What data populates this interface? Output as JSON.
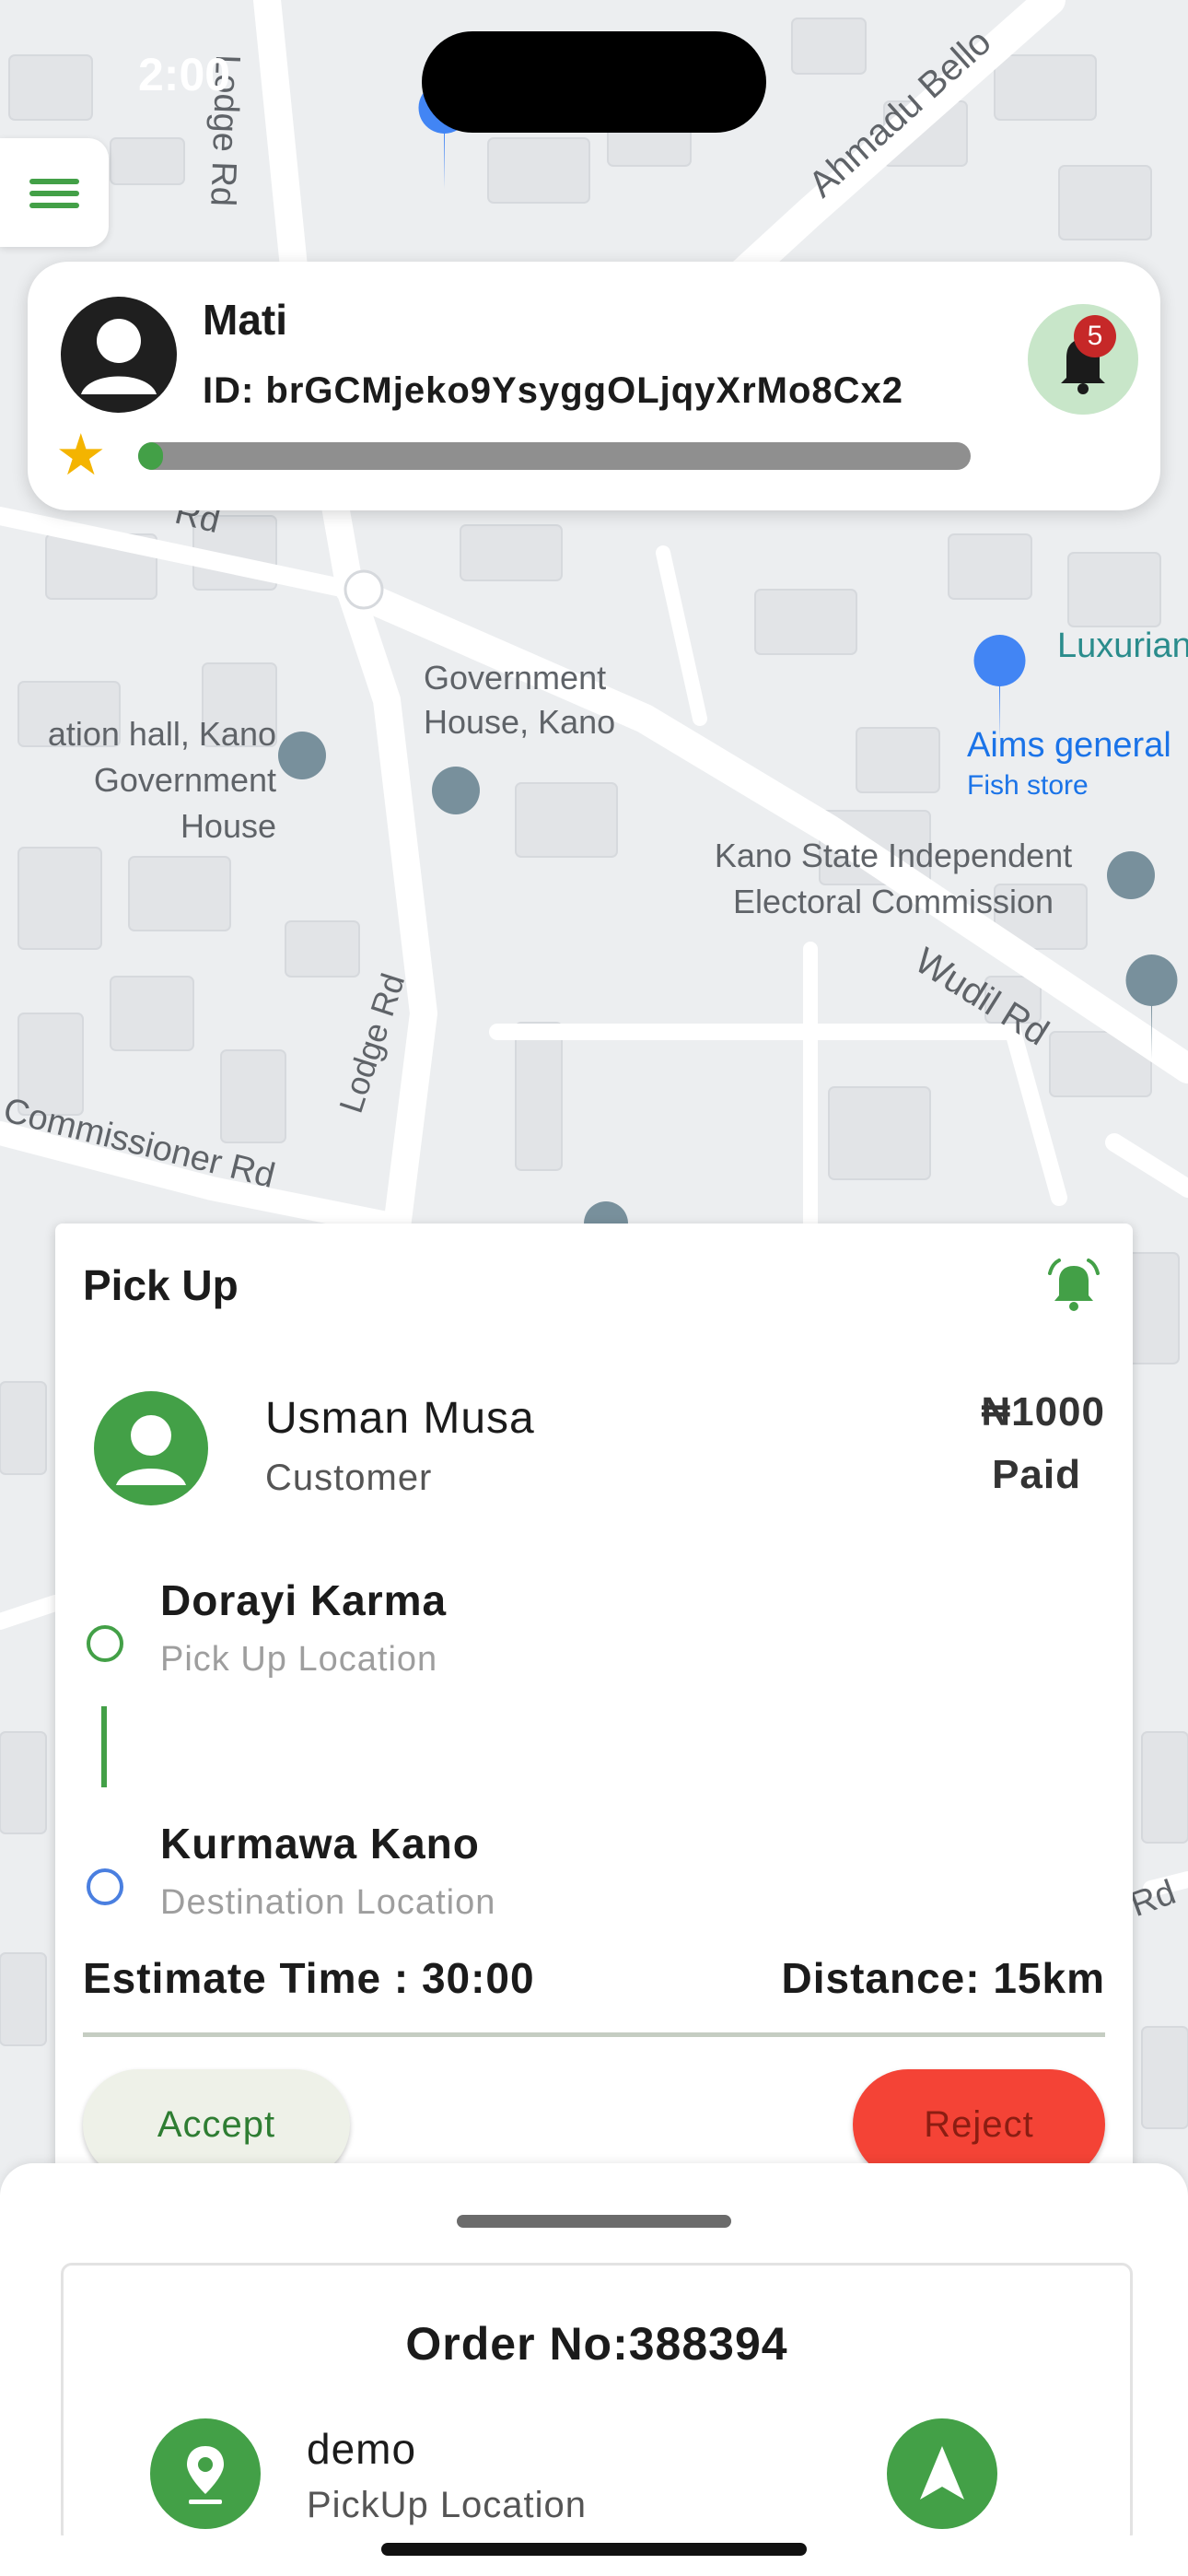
{
  "status_bar": {
    "time": "2:00"
  },
  "map": {
    "streets": [
      "Lodge Rd",
      "Ahmadu Bello",
      "Rd",
      "Wudil Rd",
      "Lodge Rd",
      "Commissioner Rd",
      "Rd"
    ],
    "places": [
      "Government House, Kano",
      "ation hall, Kano Government House",
      "Luxurian",
      "Aims general",
      "Fish store",
      "Kano State Independent Electoral Commission"
    ]
  },
  "profile": {
    "name": "Mati",
    "id": "ID: brGCMjeko9YsyggOLjqyXrMo8Cx2",
    "progress": 0.03,
    "notification_count": "5"
  },
  "pickup": {
    "title": "Pick Up",
    "customer_name": "Usman Musa",
    "customer_role": "Customer",
    "price": "₦1000",
    "payment_status": "Paid",
    "pickup_name": "Dorayi Karma",
    "pickup_label": "Pick Up Location",
    "destination_name": "Kurmawa Kano",
    "destination_label": "Destination Location",
    "estimate_time": "Estimate Time : 30:00",
    "distance": "Distance: 15km",
    "accept_label": "Accept",
    "reject_label": "Reject"
  },
  "order": {
    "number": "Order No:388394",
    "location_name": "demo",
    "location_label": "PickUp Location"
  },
  "colors": {
    "accent": "#43a047",
    "reject": "#f44336",
    "star": "#f4b400",
    "badge": "#c62828",
    "destination_ring": "#4a7fe0"
  }
}
